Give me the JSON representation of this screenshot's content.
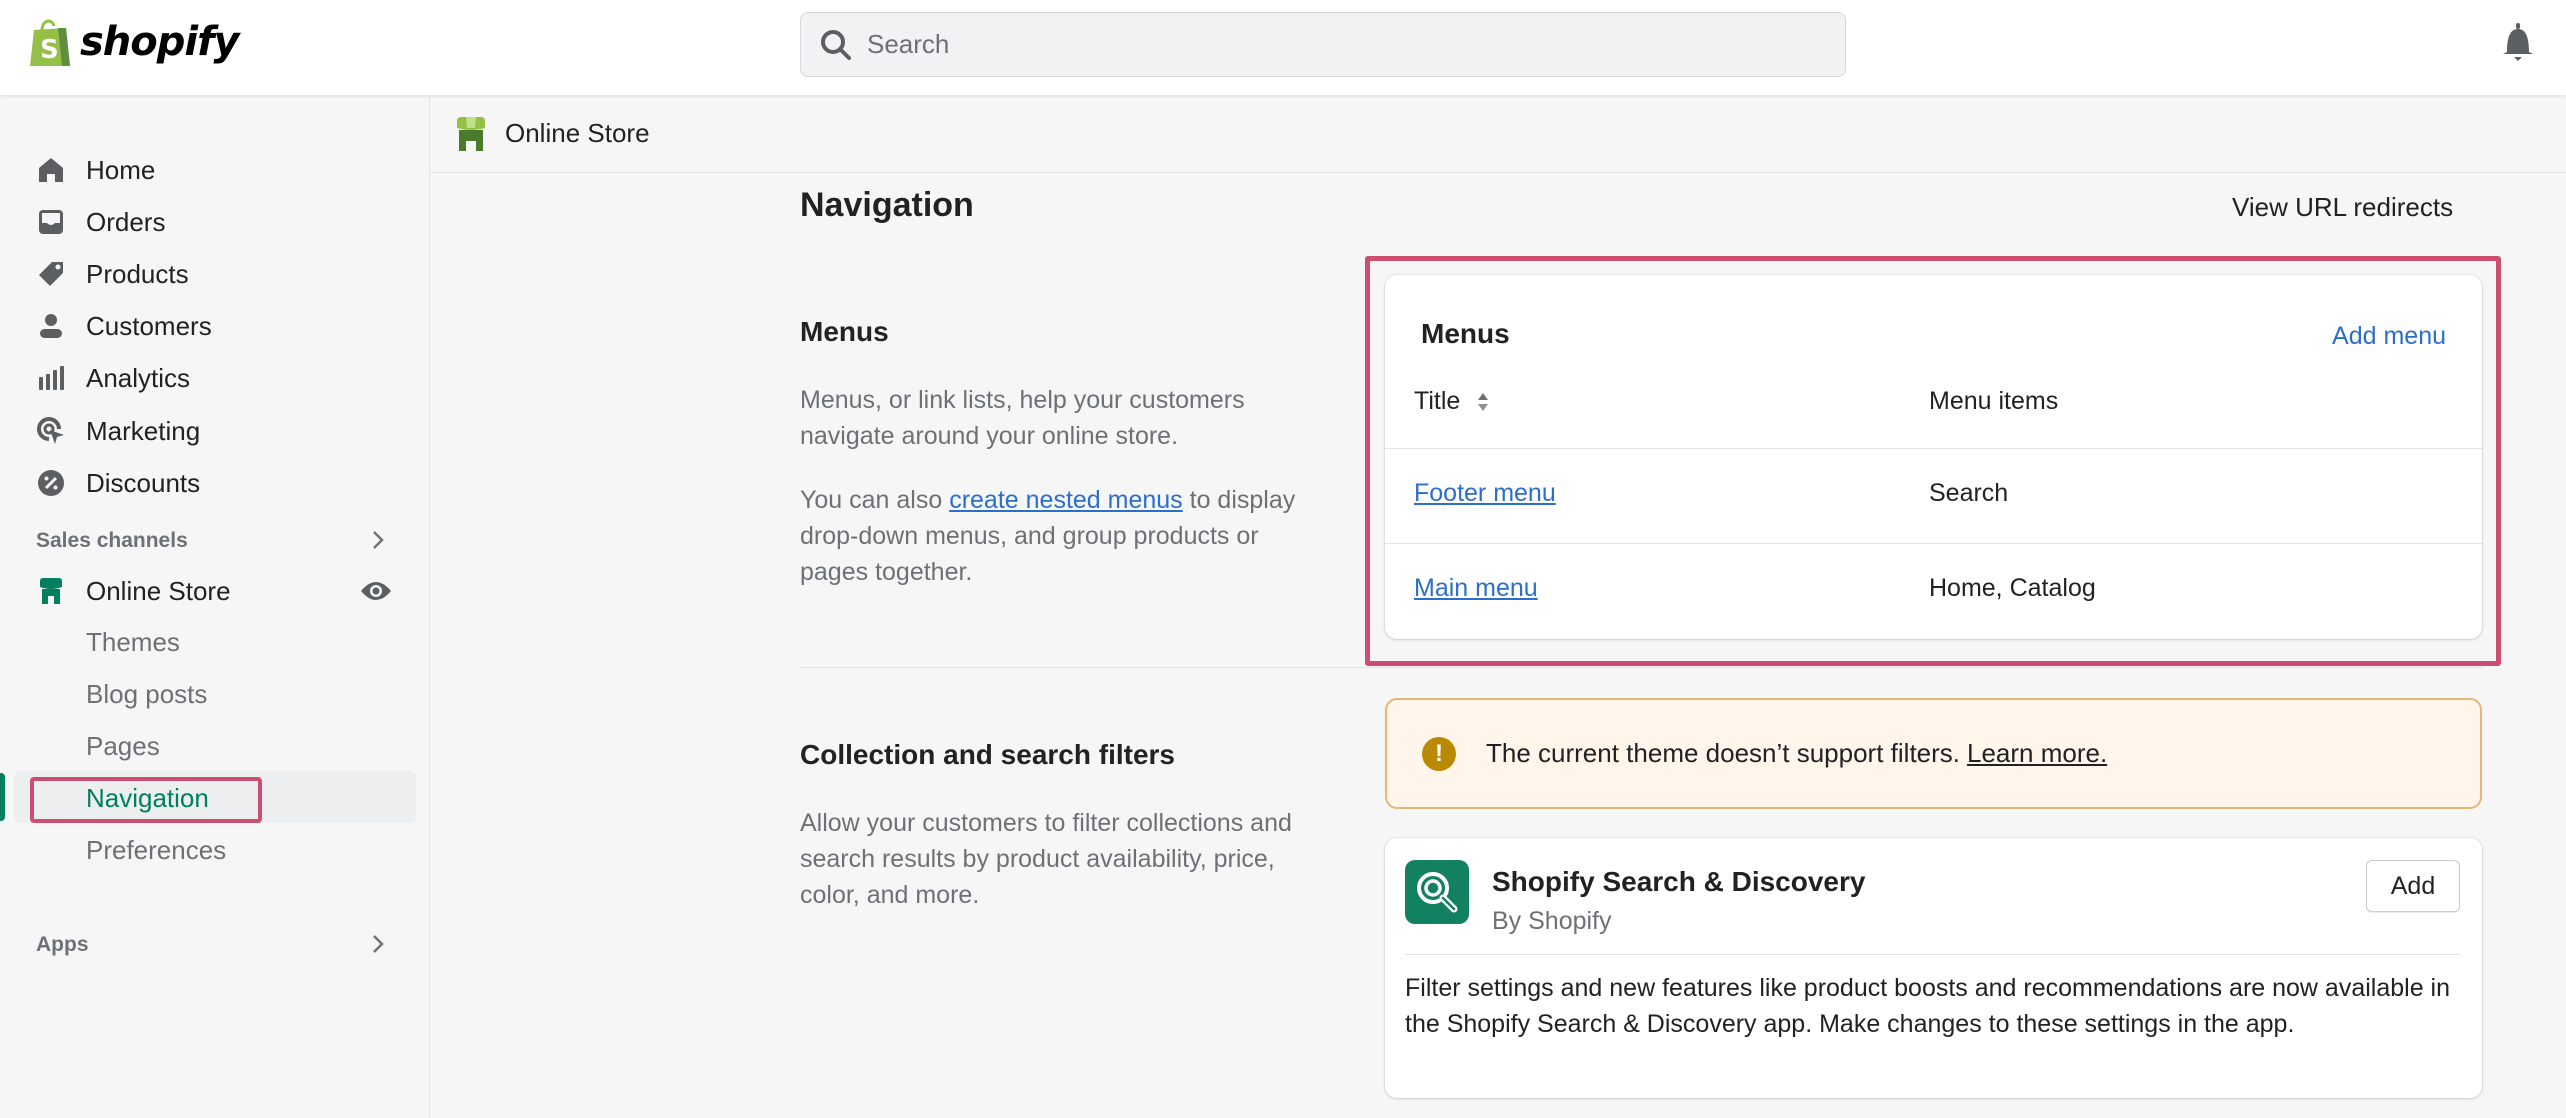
{
  "topbar": {
    "brand": "shopify",
    "search_placeholder": "Search",
    "notification_icon": "bell-icon"
  },
  "sidebar": {
    "items": [
      {
        "label": "Home",
        "icon": "home-icon"
      },
      {
        "label": "Orders",
        "icon": "orders-inbox-icon"
      },
      {
        "label": "Products",
        "icon": "tag-icon"
      },
      {
        "label": "Customers",
        "icon": "person-icon"
      },
      {
        "label": "Analytics",
        "icon": "bar-chart-icon"
      },
      {
        "label": "Marketing",
        "icon": "target-cursor-icon"
      },
      {
        "label": "Discounts",
        "icon": "discount-badge-icon"
      }
    ],
    "sales_channels_label": "Sales channels",
    "online_store": {
      "label": "Online Store",
      "icon": "store-icon",
      "action_icon": "eye-icon",
      "sub_items": [
        {
          "label": "Themes",
          "active": false
        },
        {
          "label": "Blog posts",
          "active": false
        },
        {
          "label": "Pages",
          "active": false
        },
        {
          "label": "Navigation",
          "active": true
        },
        {
          "label": "Preferences",
          "active": false
        }
      ]
    },
    "apps_label": "Apps"
  },
  "breadcrumb": {
    "label": "Online Store",
    "icon": "store-icon"
  },
  "page": {
    "title": "Navigation",
    "secondary_action": "View URL redirects"
  },
  "menus_section": {
    "title": "Menus",
    "description": "Menus, or link lists, help your customers navigate around your online store.",
    "nested_prefix": "You can also ",
    "nested_link": "create nested menus",
    "nested_suffix": " to display drop-down menus, and group products or pages together.",
    "card": {
      "title": "Menus",
      "add_label": "Add menu",
      "columns": [
        "Title",
        "Menu items"
      ],
      "rows": [
        {
          "title": "Footer menu",
          "items": "Search"
        },
        {
          "title": "Main menu",
          "items": "Home, Catalog"
        }
      ]
    }
  },
  "filters_section": {
    "title": "Collection and search filters",
    "description": "Allow your customers to filter collections and search results by product availability, price, color, and more.",
    "banner": {
      "message": "The current theme doesn’t support filters.",
      "link": "Learn more."
    },
    "app": {
      "name": "Shopify Search & Discovery",
      "by": "By Shopify",
      "add_label": "Add",
      "description": "Filter settings and new features like product boosts and recommendations are now available in the Shopify Search & Discovery app. Make changes to these settings in the app."
    }
  },
  "colors": {
    "accent_green": "#008060",
    "link_blue": "#2c6ecb",
    "highlight": "#cc4f72",
    "warning": "#b98900",
    "warning_bg": "#fff5ea"
  }
}
